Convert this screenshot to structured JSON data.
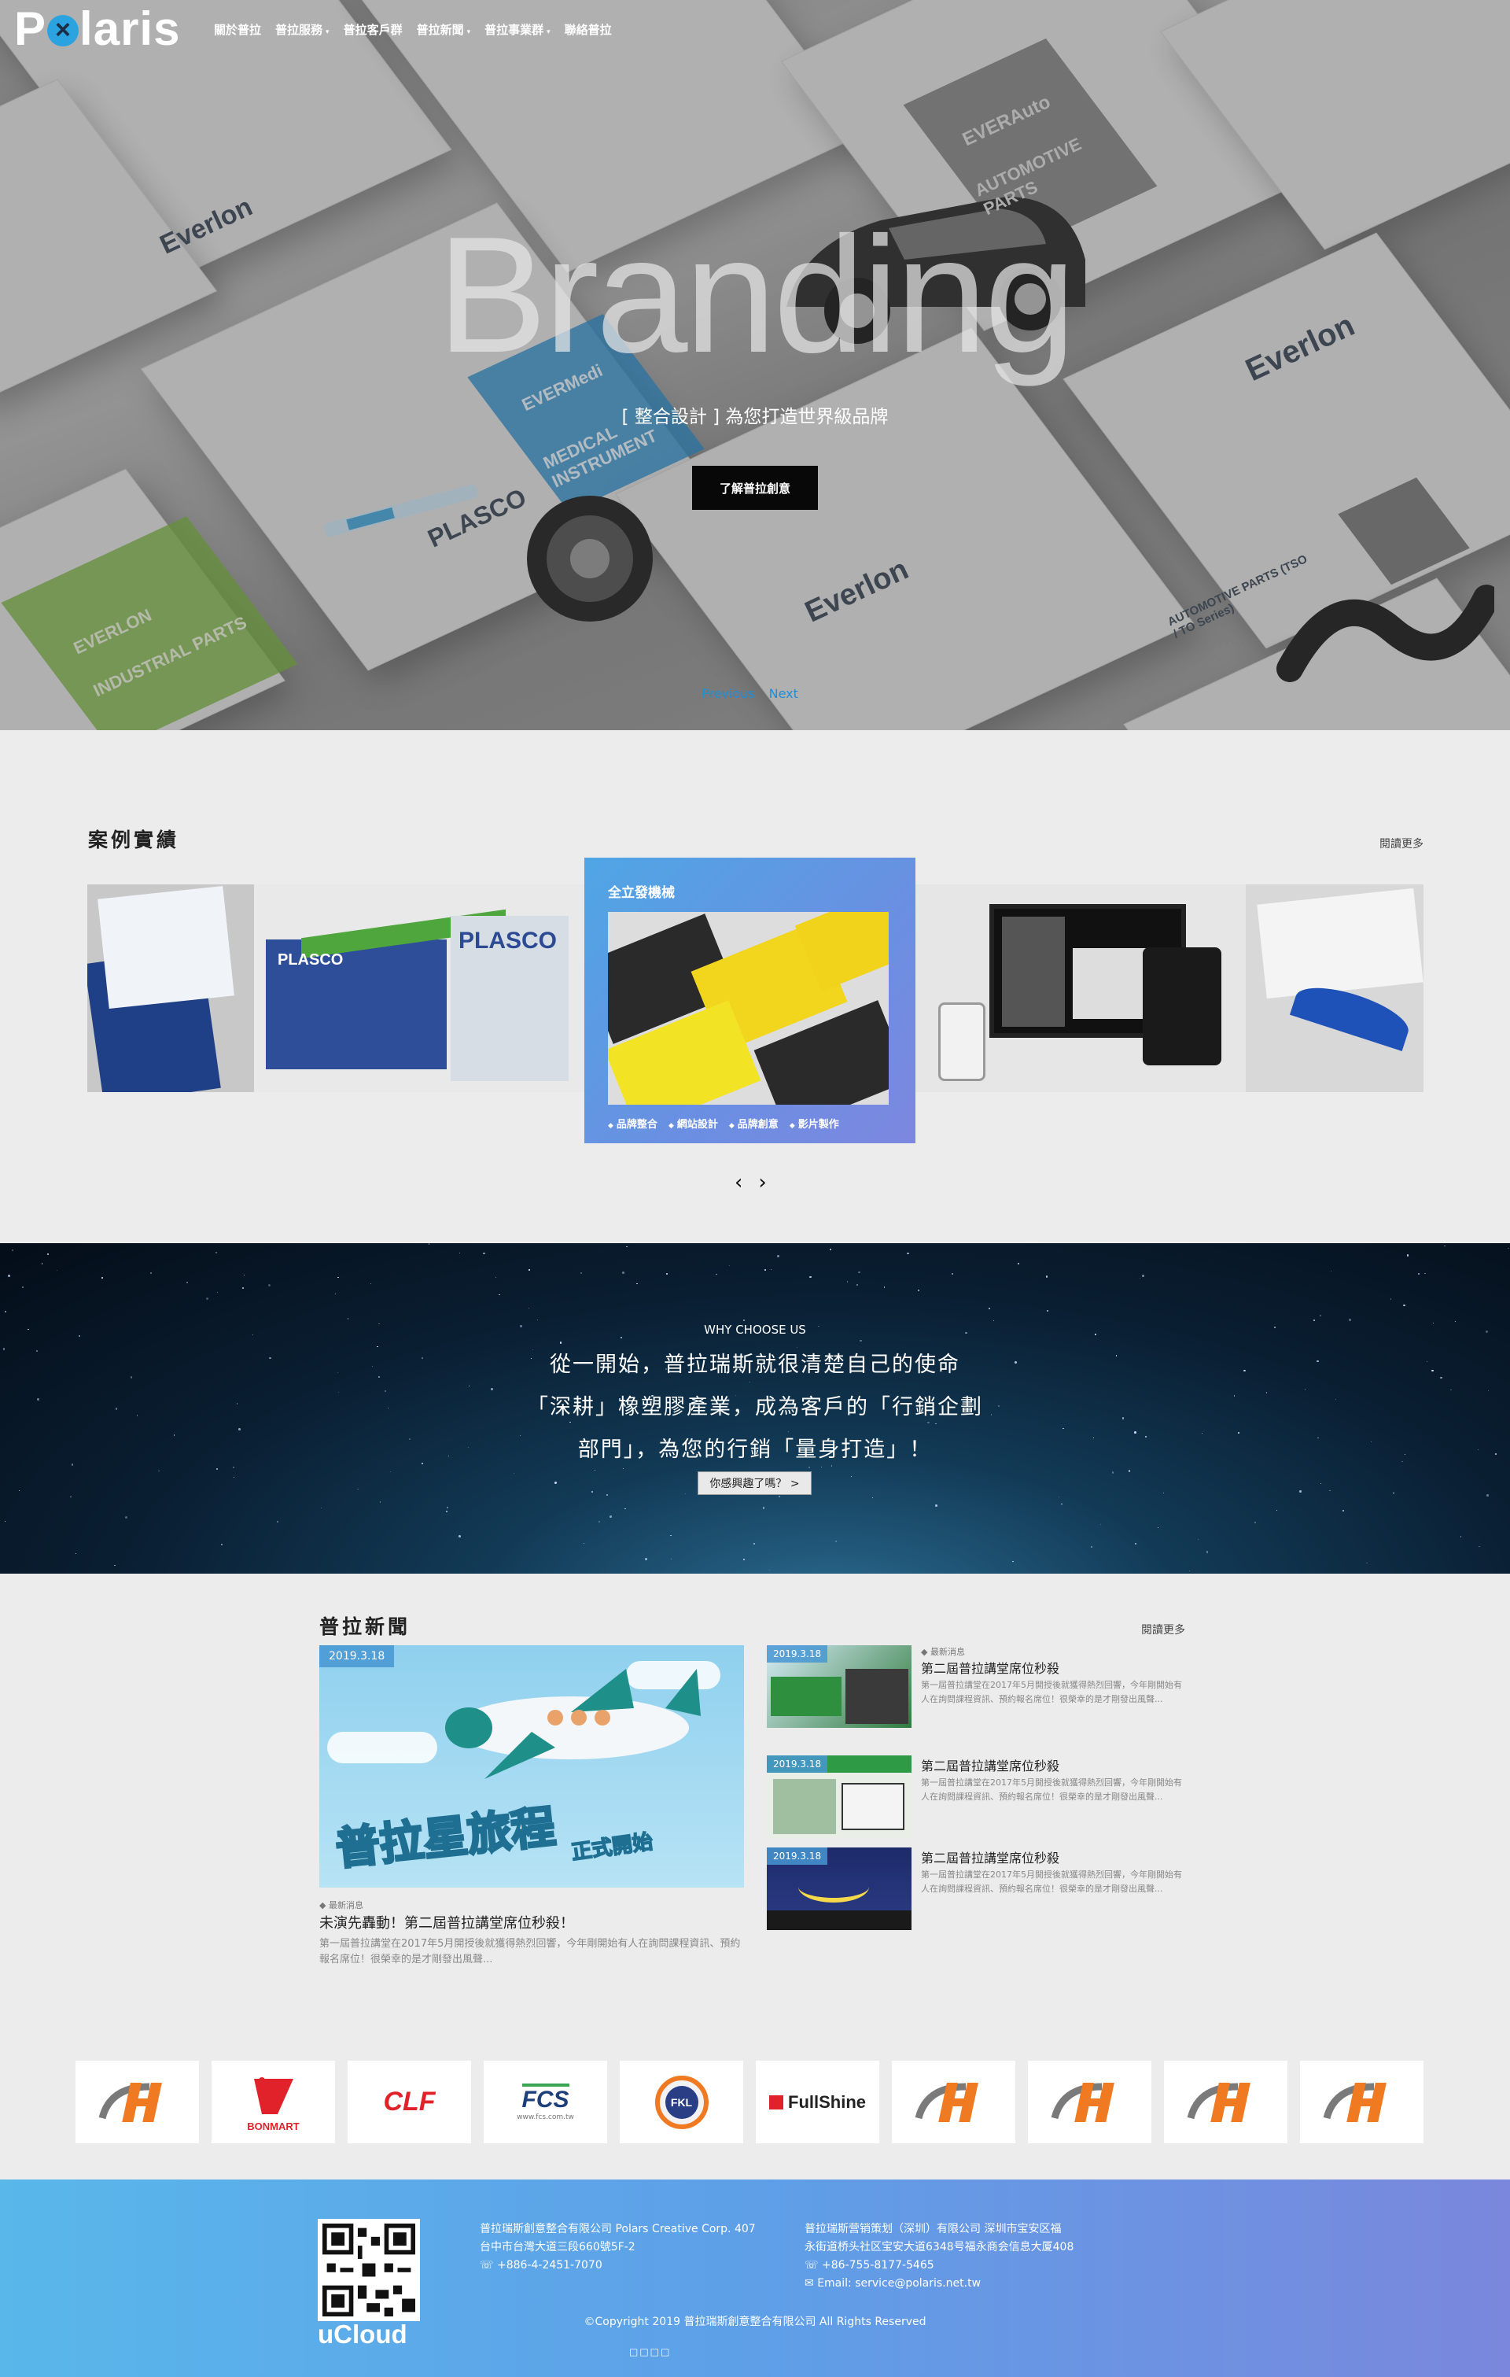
{
  "brand": {
    "logo_text": "Polaris"
  },
  "nav": {
    "items": [
      {
        "label": "關於普拉",
        "has_caret": false
      },
      {
        "label": "普拉服務",
        "has_caret": true
      },
      {
        "label": "普拉客戶群",
        "has_caret": false
      },
      {
        "label": "普拉新聞",
        "has_caret": true
      },
      {
        "label": "普拉事業群",
        "has_caret": true
      },
      {
        "label": "聯絡普拉",
        "has_caret": false
      }
    ],
    "caret_glyph": "▾"
  },
  "hero": {
    "title": "Branding",
    "subtitle": "[ 整合設計 ] 為您打造世界級品牌",
    "button": "了解普拉創意",
    "prev": "Previous",
    "next": "Next",
    "cards": {
      "everlon": "Everlon",
      "plasco": "PLASCO",
      "everauto": "EVERAuto",
      "automotive": "AUTOMOTIVE PARTS",
      "industrial": "INDUSTRIAL PARTS",
      "medical": "MEDICAL INSTRUMENT",
      "evermedi": "EVERMedi",
      "automotive2": "AUTOMOTIVE PARTS (TSO / TO Series)",
      "everlon_industrial": "EVERLON"
    }
  },
  "cases": {
    "title": "案例實績",
    "more": "閱讀更多",
    "active": {
      "title": "全立發機械",
      "tags": [
        "品牌整合",
        "網站設計",
        "品牌創意",
        "影片製作"
      ]
    },
    "plasco_logo": "PLASCO",
    "arrow_prev": "‹",
    "arrow_next": "›"
  },
  "why": {
    "kicker": "WHY CHOOSE US",
    "lines": [
      "從一開始，普拉瑞斯就很清楚自己的使命",
      "「深耕」橡塑膠產業，成為客戶的「行銷企劃",
      "部門」，為您的行銷「量身打造」！"
    ],
    "button": "你感興趣了嗎？ >"
  },
  "news": {
    "title": "普拉新聞",
    "more": "閱讀更多",
    "main": {
      "date": "2019.3.18",
      "tag": "最新消息",
      "title": "未演先轟動！第二屆普拉講堂席位秒殺！",
      "text": "第一屆普拉講堂在2017年5月開授後就獲得熱烈回響，今年剛開始有人在詢問課程資訊、預約報名席位！很榮幸的是才剛發出風聲...",
      "img_title": "普拉星旅程",
      "img_sub": "正式開始"
    },
    "items": [
      {
        "date": "2019.3.18",
        "tag": "最新消息",
        "title": "第二屆普拉講堂席位秒殺",
        "text": "第一屆普拉講堂在2017年5月開授後就獲得熱烈回響，今年剛開始有人在詢問課程資訊、預約報名席位！很榮幸的是才剛發出風聲..."
      },
      {
        "date": "2019.3.18",
        "tag": "",
        "title": "第二屆普拉講堂席位秒殺",
        "text": "第一屆普拉講堂在2017年5月開授後就獲得熱烈回響，今年剛開始有人在詢問課程資訊、預約報名席位！很榮幸的是才剛發出風聲..."
      },
      {
        "date": "2019.3.18",
        "tag": "",
        "title": "第二屆普拉講堂席位秒殺",
        "text": "第一屆普拉講堂在2017年5月開授後就獲得熱烈回響，今年剛開始有人在詢問課程資訊、預約報名席位！很榮幸的是才剛發出風聲..."
      }
    ]
  },
  "clients": [
    {
      "name": "H-logo"
    },
    {
      "name": "BONMART"
    },
    {
      "name": "CLF"
    },
    {
      "name": "FCS",
      "sub": "www.fcs.com.tw"
    },
    {
      "name": "FKL"
    },
    {
      "name": "FullShine"
    },
    {
      "name": "H-logo"
    },
    {
      "name": "H-logo"
    },
    {
      "name": "H-logo"
    },
    {
      "name": "H-logo"
    }
  ],
  "footer": {
    "qr_label": "uCloud",
    "col1": [
      "普拉瑞斯創意整合有限公司 Polars Creative Corp. 407",
      "台中市台灣大道三段660號5F-2",
      "+886-4-2451-7070"
    ],
    "col2": [
      "普拉瑞斯营销策划（深圳）有限公司 深圳市宝安区福",
      "永街道桥头社区宝安大道6348号福永商会信息大厦408",
      "+86-755-8177-5465",
      "Email: service@polaris.net.tw"
    ],
    "copyright": "©Copyright 2019 普拉瑞斯創意整合有限公司 All Rights Reserved",
    "dots": "□□□□"
  },
  "colors": {
    "accent": "#2aa3e0",
    "link_blue": "#1d8fd6",
    "footer_start": "#59b7ea",
    "footer_end": "#7a87dc"
  }
}
